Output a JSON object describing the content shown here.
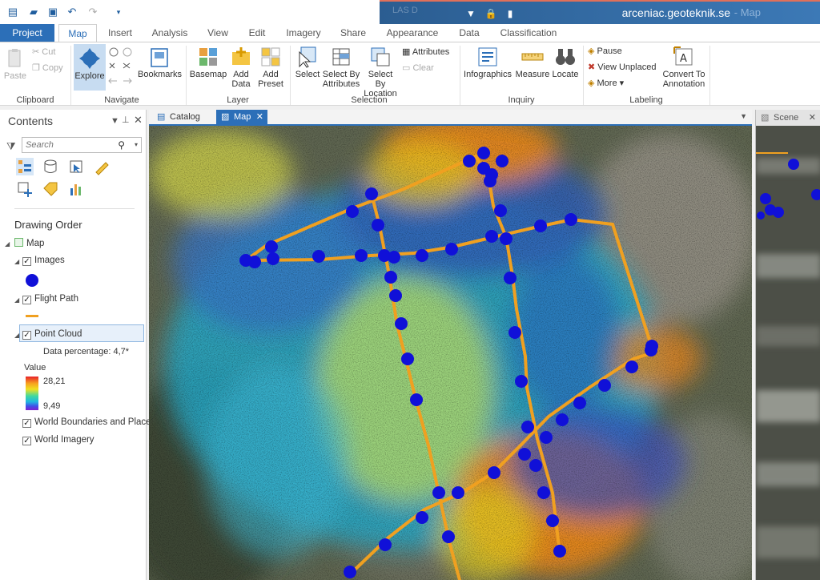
{
  "title_bar": {
    "text": "arceniac.geoteknik.se",
    "ghost_left": "LAS D",
    "ghost_right": "- Map"
  },
  "tabs": [
    "Project",
    "Map",
    "Insert",
    "Analysis",
    "View",
    "Edit",
    "Imagery",
    "Share",
    "Appearance",
    "Data",
    "Classification"
  ],
  "ribbon": {
    "clipboard": {
      "label": "Clipboard",
      "paste": "Paste",
      "cut": "Cut",
      "copy": "Copy"
    },
    "navigate": {
      "label": "Navigate",
      "explore": "Explore",
      "bookmarks": "Bookmarks"
    },
    "layer": {
      "label": "Layer",
      "basemap": "Basemap",
      "add_data": "Add Data",
      "add_preset": "Add Preset"
    },
    "selection": {
      "label": "Selection",
      "select": "Select",
      "select_by_attributes": "Select By Attributes",
      "select_by_location": "Select By Location",
      "attributes": "Attributes",
      "clear": "Clear"
    },
    "inquiry": {
      "label": "Inquiry",
      "infographics": "Infographics",
      "measure": "Measure",
      "locate": "Locate"
    },
    "labeling": {
      "label": "Labeling",
      "pause": "Pause",
      "view_unplaced": "View Unplaced",
      "more": "More",
      "convert": "Convert To Annotation"
    }
  },
  "contents": {
    "title": "Contents",
    "search_placeholder": "Search",
    "drawing_order": "Drawing Order",
    "layers": {
      "map": "Map",
      "images": "Images",
      "flight_path": "Flight Path",
      "point_cloud": "Point Cloud",
      "data_percentage": "Data percentage: 4,7*",
      "value_label": "Value",
      "value_max": "28,21",
      "value_min": "9,49",
      "world_boundaries": "World Boundaries and Places",
      "world_imagery": "World Imagery"
    }
  },
  "doc_tabs": {
    "catalog": "Catalog",
    "map": "Map",
    "scene": "Scene"
  },
  "colors": {
    "accent": "#2c6fb8",
    "flight_path": "#f0a020",
    "image_point": "#1010d8"
  }
}
